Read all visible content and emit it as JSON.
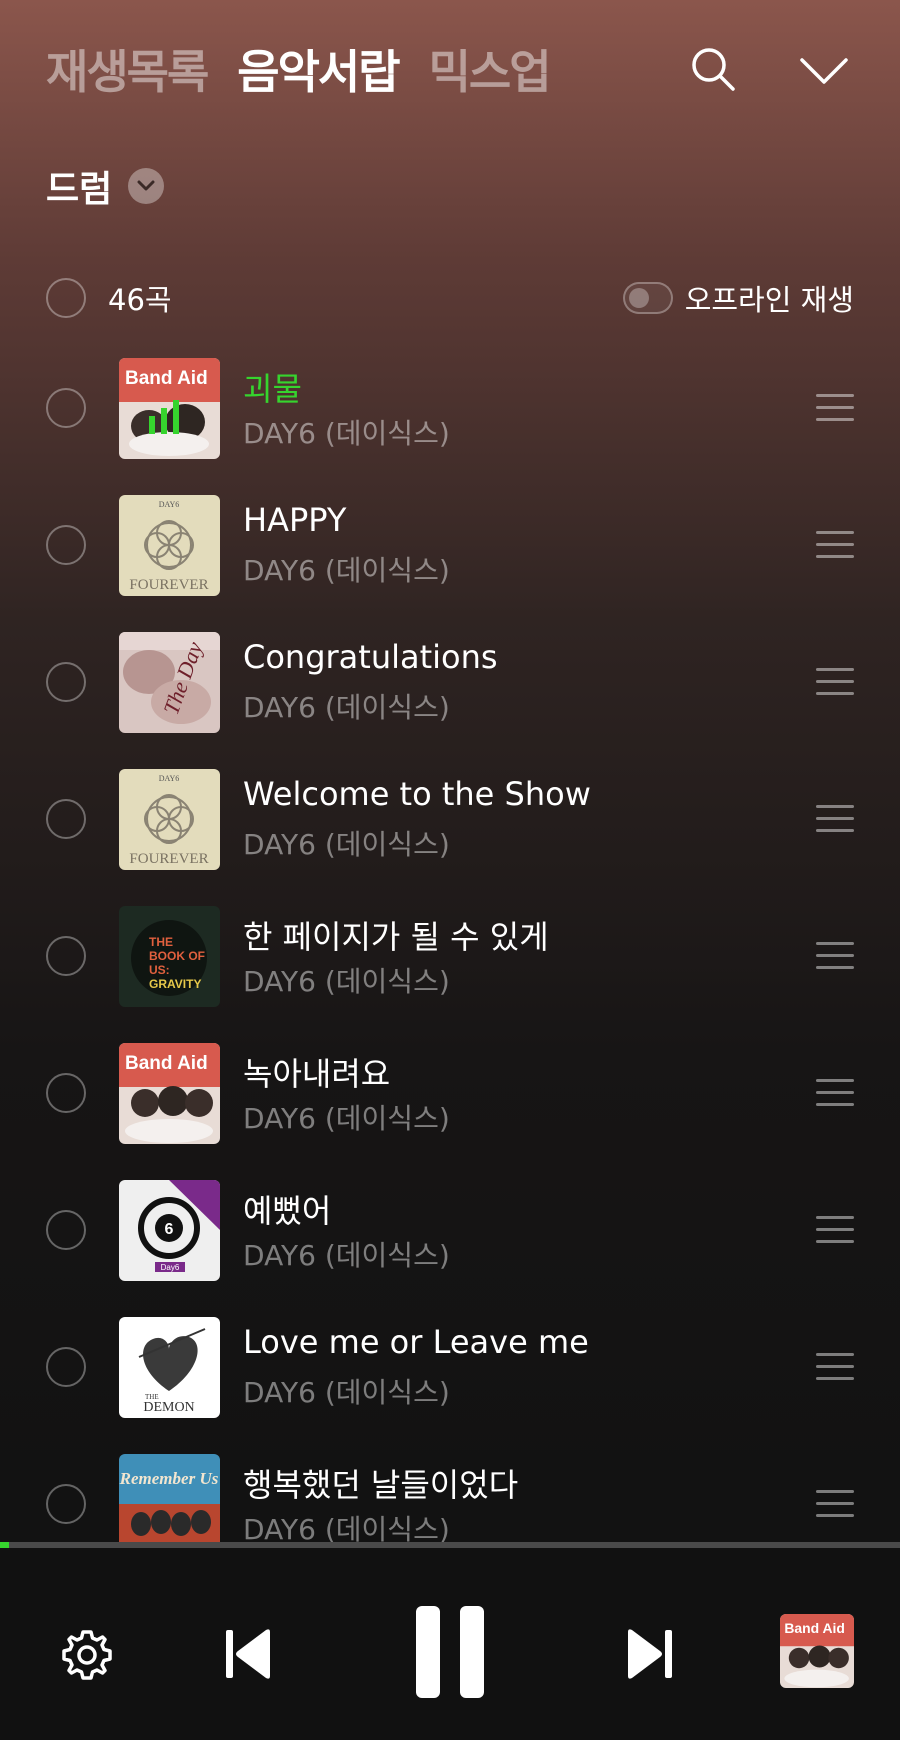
{
  "header": {
    "tabs": [
      {
        "label": "재생목록",
        "active": false
      },
      {
        "label": "음악서랍",
        "active": true
      },
      {
        "label": "믹스업",
        "active": false
      }
    ]
  },
  "playlist": {
    "name": "드럼"
  },
  "list_header": {
    "count_label": "46곡",
    "offline_label": "오프라인 재생",
    "offline_enabled": false
  },
  "songs": [
    {
      "title": "괴물",
      "artist": "DAY6 (데이식스)",
      "playing": true,
      "cover": "band-aid"
    },
    {
      "title": "HAPPY",
      "artist": "DAY6 (데이식스)",
      "playing": false,
      "cover": "fourever"
    },
    {
      "title": "Congratulations",
      "artist": "DAY6 (데이식스)",
      "playing": false,
      "cover": "the-day"
    },
    {
      "title": "Welcome to the Show",
      "artist": "DAY6 (데이식스)",
      "playing": false,
      "cover": "fourever"
    },
    {
      "title": "한 페이지가 될 수 있게",
      "artist": "DAY6 (데이식스)",
      "playing": false,
      "cover": "book-of-us-gravity"
    },
    {
      "title": "녹아내려요",
      "artist": "DAY6 (데이식스)",
      "playing": false,
      "cover": "band-aid"
    },
    {
      "title": "예뻤어",
      "artist": "DAY6 (데이식스)",
      "playing": false,
      "cover": "every-day6"
    },
    {
      "title": "Love me or Leave me",
      "artist": "DAY6 (데이식스)",
      "playing": false,
      "cover": "the-demon"
    },
    {
      "title": "행복했던 날들이었다",
      "artist": "DAY6 (데이식스)",
      "playing": false,
      "cover": "remember-us"
    }
  ],
  "cover_text": {
    "band_aid": "Band Aid",
    "fourever_top": "DAY6",
    "fourever": "FOUREVER",
    "the_day": "The Day",
    "gravity": [
      "THE",
      "BOOK OF",
      "US:",
      "GRAVITY"
    ],
    "every_day6": "Day6",
    "the_demon": [
      "THE",
      "DEMON"
    ],
    "remember_us": "Remember Us"
  },
  "player": {
    "progress": 0.01,
    "state": "playing"
  },
  "colors": {
    "accent_green": "#36d42e"
  }
}
